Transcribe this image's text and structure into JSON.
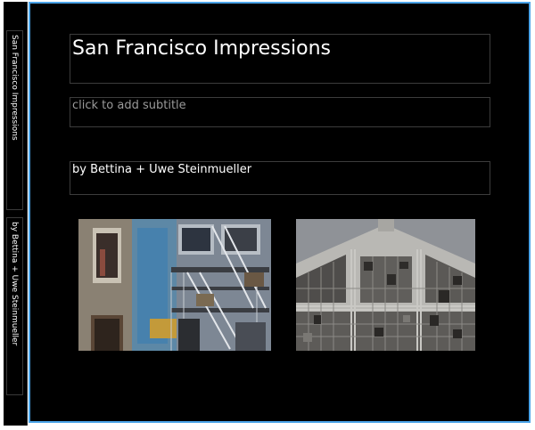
{
  "spine": {
    "title": "San Francisco Impressions",
    "author": "by  Bettina + Uwe Steinmueller"
  },
  "cover": {
    "title": "San Francisco Impressions",
    "subtitle_placeholder": "click to add subtitle",
    "author": "by  Bettina + Uwe Steinmueller"
  },
  "photos": [
    {
      "subject": "building facade with fire escape"
    },
    {
      "subject": "warehouse facade with broken windows"
    }
  ]
}
